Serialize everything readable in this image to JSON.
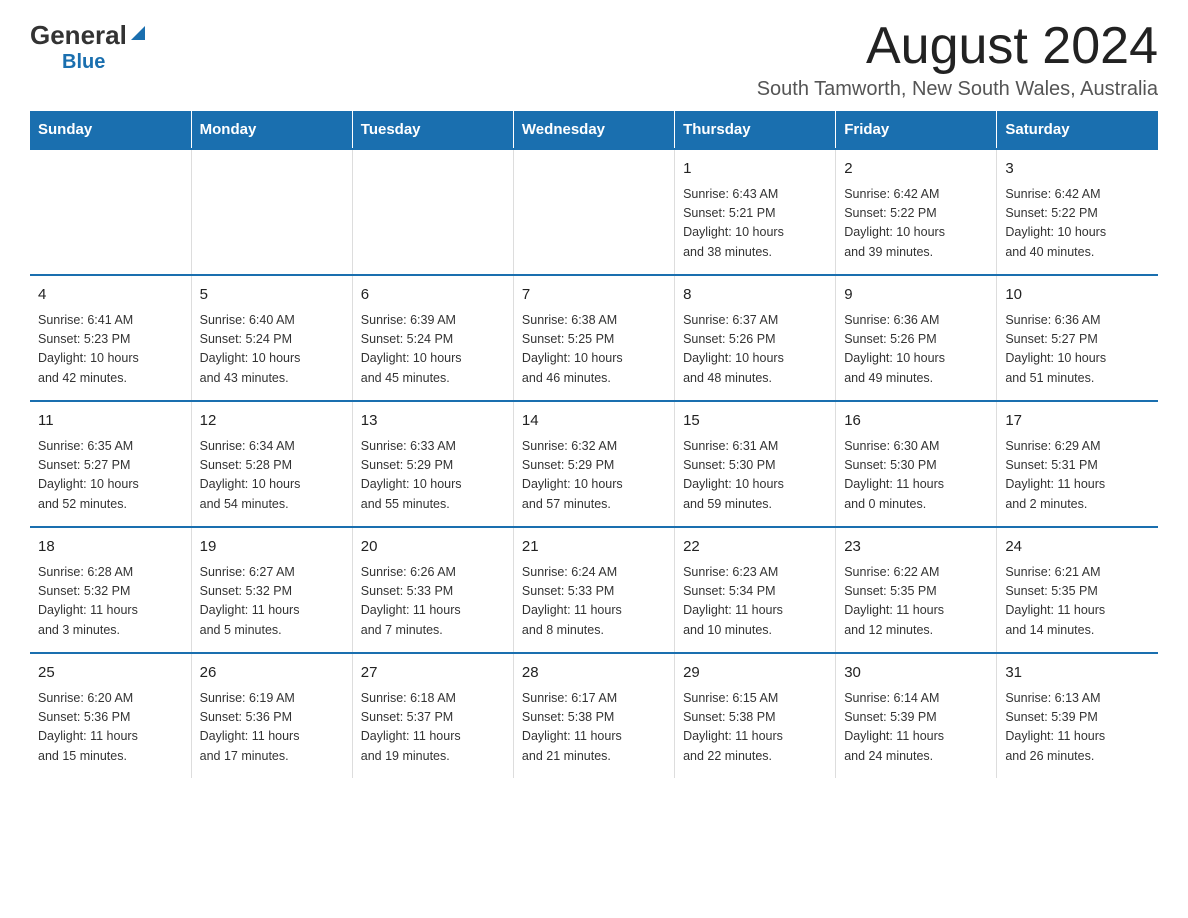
{
  "header": {
    "logo_general": "General",
    "logo_blue": "Blue",
    "month_title": "August 2024",
    "location": "South Tamworth, New South Wales, Australia"
  },
  "days_of_week": [
    "Sunday",
    "Monday",
    "Tuesday",
    "Wednesday",
    "Thursday",
    "Friday",
    "Saturday"
  ],
  "weeks": [
    [
      {
        "day": "",
        "info": ""
      },
      {
        "day": "",
        "info": ""
      },
      {
        "day": "",
        "info": ""
      },
      {
        "day": "",
        "info": ""
      },
      {
        "day": "1",
        "info": "Sunrise: 6:43 AM\nSunset: 5:21 PM\nDaylight: 10 hours\nand 38 minutes."
      },
      {
        "day": "2",
        "info": "Sunrise: 6:42 AM\nSunset: 5:22 PM\nDaylight: 10 hours\nand 39 minutes."
      },
      {
        "day": "3",
        "info": "Sunrise: 6:42 AM\nSunset: 5:22 PM\nDaylight: 10 hours\nand 40 minutes."
      }
    ],
    [
      {
        "day": "4",
        "info": "Sunrise: 6:41 AM\nSunset: 5:23 PM\nDaylight: 10 hours\nand 42 minutes."
      },
      {
        "day": "5",
        "info": "Sunrise: 6:40 AM\nSunset: 5:24 PM\nDaylight: 10 hours\nand 43 minutes."
      },
      {
        "day": "6",
        "info": "Sunrise: 6:39 AM\nSunset: 5:24 PM\nDaylight: 10 hours\nand 45 minutes."
      },
      {
        "day": "7",
        "info": "Sunrise: 6:38 AM\nSunset: 5:25 PM\nDaylight: 10 hours\nand 46 minutes."
      },
      {
        "day": "8",
        "info": "Sunrise: 6:37 AM\nSunset: 5:26 PM\nDaylight: 10 hours\nand 48 minutes."
      },
      {
        "day": "9",
        "info": "Sunrise: 6:36 AM\nSunset: 5:26 PM\nDaylight: 10 hours\nand 49 minutes."
      },
      {
        "day": "10",
        "info": "Sunrise: 6:36 AM\nSunset: 5:27 PM\nDaylight: 10 hours\nand 51 minutes."
      }
    ],
    [
      {
        "day": "11",
        "info": "Sunrise: 6:35 AM\nSunset: 5:27 PM\nDaylight: 10 hours\nand 52 minutes."
      },
      {
        "day": "12",
        "info": "Sunrise: 6:34 AM\nSunset: 5:28 PM\nDaylight: 10 hours\nand 54 minutes."
      },
      {
        "day": "13",
        "info": "Sunrise: 6:33 AM\nSunset: 5:29 PM\nDaylight: 10 hours\nand 55 minutes."
      },
      {
        "day": "14",
        "info": "Sunrise: 6:32 AM\nSunset: 5:29 PM\nDaylight: 10 hours\nand 57 minutes."
      },
      {
        "day": "15",
        "info": "Sunrise: 6:31 AM\nSunset: 5:30 PM\nDaylight: 10 hours\nand 59 minutes."
      },
      {
        "day": "16",
        "info": "Sunrise: 6:30 AM\nSunset: 5:30 PM\nDaylight: 11 hours\nand 0 minutes."
      },
      {
        "day": "17",
        "info": "Sunrise: 6:29 AM\nSunset: 5:31 PM\nDaylight: 11 hours\nand 2 minutes."
      }
    ],
    [
      {
        "day": "18",
        "info": "Sunrise: 6:28 AM\nSunset: 5:32 PM\nDaylight: 11 hours\nand 3 minutes."
      },
      {
        "day": "19",
        "info": "Sunrise: 6:27 AM\nSunset: 5:32 PM\nDaylight: 11 hours\nand 5 minutes."
      },
      {
        "day": "20",
        "info": "Sunrise: 6:26 AM\nSunset: 5:33 PM\nDaylight: 11 hours\nand 7 minutes."
      },
      {
        "day": "21",
        "info": "Sunrise: 6:24 AM\nSunset: 5:33 PM\nDaylight: 11 hours\nand 8 minutes."
      },
      {
        "day": "22",
        "info": "Sunrise: 6:23 AM\nSunset: 5:34 PM\nDaylight: 11 hours\nand 10 minutes."
      },
      {
        "day": "23",
        "info": "Sunrise: 6:22 AM\nSunset: 5:35 PM\nDaylight: 11 hours\nand 12 minutes."
      },
      {
        "day": "24",
        "info": "Sunrise: 6:21 AM\nSunset: 5:35 PM\nDaylight: 11 hours\nand 14 minutes."
      }
    ],
    [
      {
        "day": "25",
        "info": "Sunrise: 6:20 AM\nSunset: 5:36 PM\nDaylight: 11 hours\nand 15 minutes."
      },
      {
        "day": "26",
        "info": "Sunrise: 6:19 AM\nSunset: 5:36 PM\nDaylight: 11 hours\nand 17 minutes."
      },
      {
        "day": "27",
        "info": "Sunrise: 6:18 AM\nSunset: 5:37 PM\nDaylight: 11 hours\nand 19 minutes."
      },
      {
        "day": "28",
        "info": "Sunrise: 6:17 AM\nSunset: 5:38 PM\nDaylight: 11 hours\nand 21 minutes."
      },
      {
        "day": "29",
        "info": "Sunrise: 6:15 AM\nSunset: 5:38 PM\nDaylight: 11 hours\nand 22 minutes."
      },
      {
        "day": "30",
        "info": "Sunrise: 6:14 AM\nSunset: 5:39 PM\nDaylight: 11 hours\nand 24 minutes."
      },
      {
        "day": "31",
        "info": "Sunrise: 6:13 AM\nSunset: 5:39 PM\nDaylight: 11 hours\nand 26 minutes."
      }
    ]
  ]
}
